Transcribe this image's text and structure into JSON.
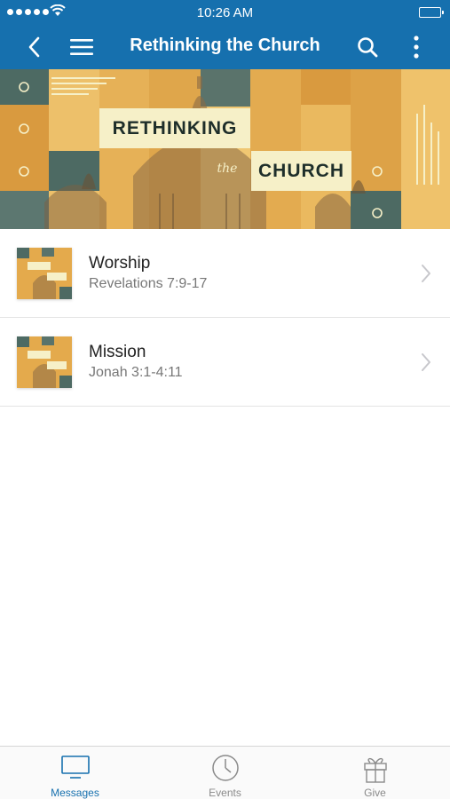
{
  "status_bar": {
    "time": "10:26 AM"
  },
  "nav": {
    "title": "Rethinking the Church",
    "back_icon": "chevron-left-icon",
    "menu_icon": "hamburger-icon",
    "search_icon": "search-icon",
    "more_icon": "more-vertical-icon"
  },
  "banner": {
    "line1": "RETHINKING",
    "line2": "the",
    "line3": "CHURCH"
  },
  "messages": [
    {
      "title": "Worship",
      "subtitle": "Revelations 7:9-17"
    },
    {
      "title": "Mission",
      "subtitle": "Jonah 3:1-4:11"
    }
  ],
  "thumb_text": {
    "line1": "RETHINKING",
    "line2": "CHURCH"
  },
  "tabs": [
    {
      "label": "Messages",
      "icon": "monitor-icon",
      "active": true
    },
    {
      "label": "Events",
      "icon": "clock-icon",
      "active": false
    },
    {
      "label": "Give",
      "icon": "gift-icon",
      "active": false
    }
  ],
  "colors": {
    "brand": "#1670ae",
    "banner_gold": "#e8b04f",
    "banner_teal": "#4d6a63"
  }
}
